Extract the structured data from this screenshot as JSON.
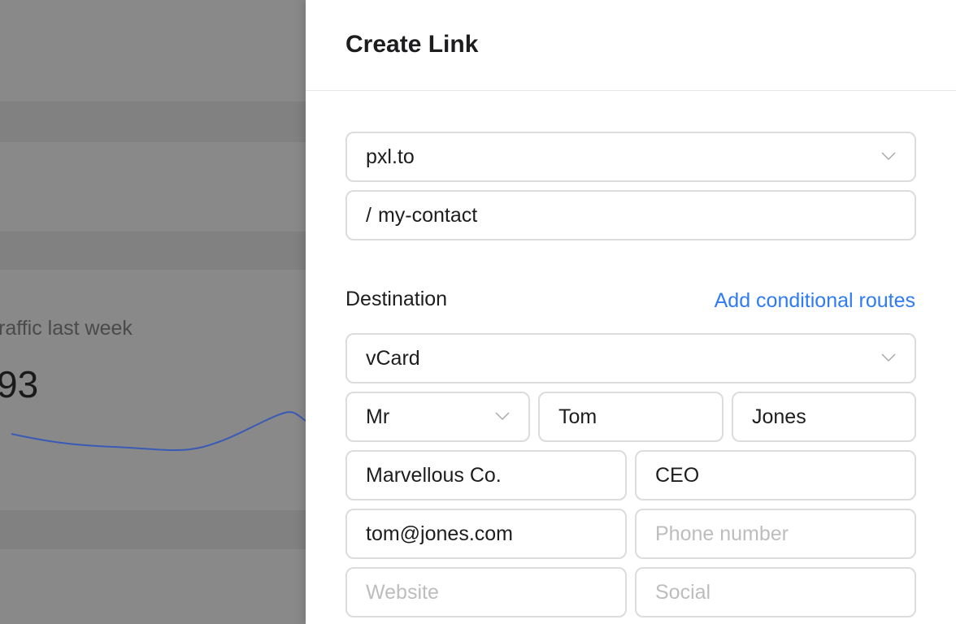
{
  "background": {
    "stat_label": "raffic last week",
    "stat_value": "93",
    "sparkline_color": "#3a5bb5"
  },
  "panel": {
    "title": "Create Link",
    "domain_select": {
      "value": "pxl.to",
      "icon": "chevron-down-icon"
    },
    "slug": {
      "prefix": "/",
      "value": "my-contact"
    },
    "destination_label": "Destination",
    "conditional_routes_link": "Add conditional routes",
    "accent_color": "#2f7bf5",
    "type_select": {
      "value": "vCard"
    },
    "vcard": {
      "salutation": "Mr",
      "first_name": "Tom",
      "last_name": "Jones",
      "company": "Marvellous Co.",
      "title": "CEO",
      "email": "tom@jones.com",
      "phone_placeholder": "Phone number",
      "website_placeholder": "Website",
      "social_placeholder": "Social"
    }
  }
}
